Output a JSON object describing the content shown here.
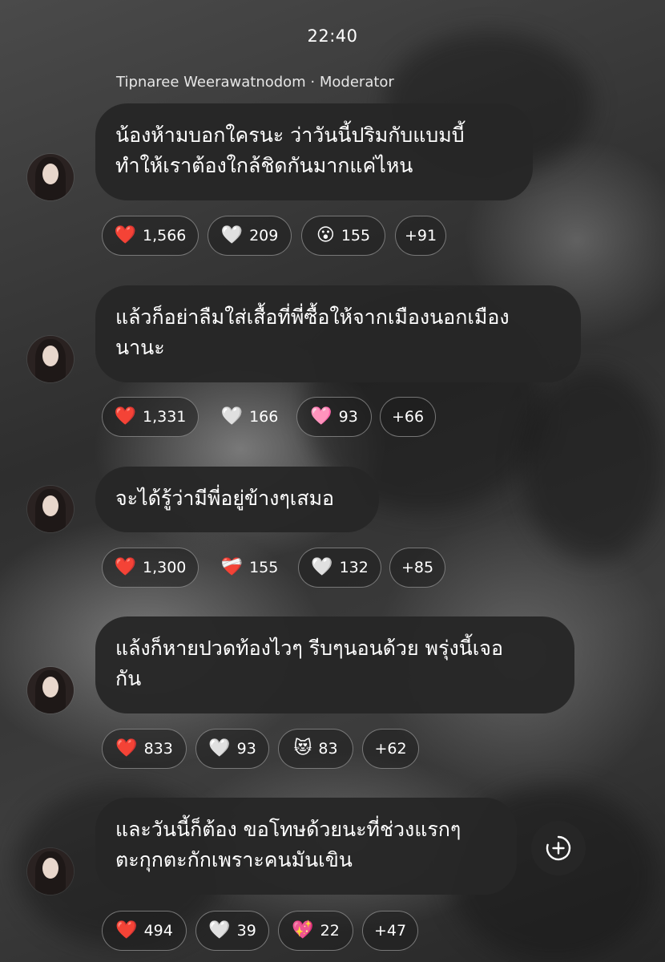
{
  "status": {
    "time": "22:40"
  },
  "header": {
    "author": "Tipnaree Weerawatnodom · Moderator"
  },
  "messages": [
    {
      "lines": [
        "น้องห้ามบอกใครนะ ว่าวันนี้ปริมกับแบมบี้",
        "ทำให้เราต้องใกล้ชิดกันมากแค่ไหน"
      ],
      "reactions": [
        {
          "icon": "red-heart-icon",
          "emoji": "❤️",
          "count": "1,566"
        },
        {
          "icon": "white-heart-icon",
          "emoji": "🤍",
          "count": "209"
        },
        {
          "icon": "surprised-face-icon",
          "emoji": "😮",
          "count": "155"
        },
        {
          "icon": "",
          "emoji": "",
          "count": "+91"
        }
      ]
    },
    {
      "lines": [
        "แล้วก็อย่าลืมใส่เสื้อที่พี่ซื้อให้จากเมืองนอกเมือง",
        "นานะ"
      ],
      "reactions": [
        {
          "icon": "red-heart-icon",
          "emoji": "❤️",
          "count": "1,331"
        },
        {
          "icon": "white-heart-icon",
          "emoji": "🤍",
          "count": "166"
        },
        {
          "icon": "pink-heart-icon",
          "emoji": "🩷",
          "count": "93"
        },
        {
          "icon": "",
          "emoji": "",
          "count": "+66"
        }
      ]
    },
    {
      "lines": [
        "จะได้รู้ว่ามีพี่อยู่ข้างๆเสมอ"
      ],
      "reactions": [
        {
          "icon": "red-heart-icon",
          "emoji": "❤️",
          "count": "1,300"
        },
        {
          "icon": "mending-heart-icon",
          "emoji": "❤️‍🩹",
          "count": "155"
        },
        {
          "icon": "white-heart-icon",
          "emoji": "🤍",
          "count": "132"
        },
        {
          "icon": "",
          "emoji": "",
          "count": "+85"
        }
      ]
    },
    {
      "lines": [
        "แล้งก็หายปวดท้องไวๆ รีบๆนอนด้วย พรุ่งนี้เจอ",
        "กัน"
      ],
      "reactions": [
        {
          "icon": "red-heart-icon",
          "emoji": "❤️",
          "count": "833"
        },
        {
          "icon": "white-heart-icon",
          "emoji": "🤍",
          "count": "93"
        },
        {
          "icon": "heart-eyes-cat-icon",
          "emoji": "😻",
          "count": "83"
        },
        {
          "icon": "",
          "emoji": "",
          "count": "+62"
        }
      ]
    },
    {
      "lines": [
        "และวันนี้ก็ต้อง ขอโทษด้วยนะที่ช่วงแรกๆ",
        "ตะกุกตะกักเพราะคนมันเขิน"
      ],
      "reactions": [
        {
          "icon": "red-heart-icon",
          "emoji": "❤️",
          "count": "494"
        },
        {
          "icon": "white-heart-icon",
          "emoji": "🤍",
          "count": "39"
        },
        {
          "icon": "sparkling-heart-icon",
          "emoji": "💖",
          "count": "22"
        },
        {
          "icon": "",
          "emoji": "",
          "count": "+47"
        }
      ]
    }
  ],
  "actions": {
    "add_reaction_icon": "add-circle-icon"
  }
}
